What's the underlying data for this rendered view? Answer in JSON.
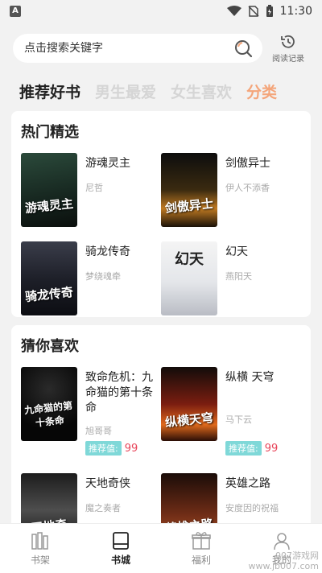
{
  "status": {
    "app_letter": "A",
    "time": "11:30"
  },
  "search": {
    "placeholder": "点击搜索关键字",
    "history_label": "阅读记录"
  },
  "tabs": [
    {
      "label": "推荐好书",
      "state": "active"
    },
    {
      "label": "男生最爱",
      "state": "inactive"
    },
    {
      "label": "女生喜欢",
      "state": "inactive"
    },
    {
      "label": "分类",
      "state": "accent"
    }
  ],
  "hot": {
    "title": "热门精选",
    "books": [
      {
        "name": "游魂灵主",
        "author": "尼哲",
        "cover_text": "游魂灵主"
      },
      {
        "name": "剑傲异士",
        "author": "伊人不添香",
        "cover_text": "剑傲异士"
      },
      {
        "name": "骑龙传奇",
        "author": "梦绕魂牵",
        "cover_text": "骑龙传奇"
      },
      {
        "name": "幻天",
        "author": "燕阳天",
        "cover_text": "幻天"
      }
    ]
  },
  "guess": {
    "title": "猜你喜欢",
    "books": [
      {
        "name": "致命危机：九命猫的第十条命",
        "author": "旭哥哥",
        "score_label": "推荐值:",
        "score": "99",
        "cover_text": "九命猫的第十条命"
      },
      {
        "name": "纵横 天穹",
        "author": "马下云",
        "score_label": "推荐值:",
        "score": "99",
        "cover_text": "纵横天穹"
      },
      {
        "name": "天地奇侠",
        "author": "魔之奏者",
        "cover_text": "天地奇"
      },
      {
        "name": "英雄之路",
        "author": "安度因的祝福",
        "cover_text": "英雄之路"
      }
    ]
  },
  "nav": [
    {
      "label": "书架",
      "icon": "bookshelf-icon"
    },
    {
      "label": "书城",
      "icon": "bookstore-icon",
      "state": "active"
    },
    {
      "label": "福利",
      "icon": "gift-icon"
    },
    {
      "label": "我的",
      "icon": "profile-icon"
    }
  ],
  "watermark": "007游戏网 www.jb007.com"
}
